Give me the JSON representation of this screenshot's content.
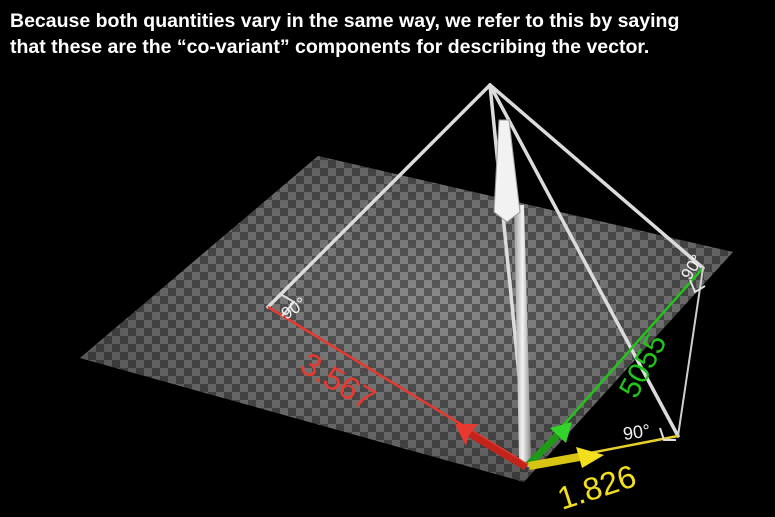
{
  "caption": {
    "line1": "Because both quantities vary in the same way, we refer to this by saying",
    "line2": "that these are the “co-variant” components for describing the vector."
  },
  "labels": {
    "red_value": "3.567",
    "green_value": "5055",
    "yellow_value": "1.826",
    "angle_red": "90°",
    "angle_green": "90°",
    "angle_yellow": "90°"
  },
  "colors": {
    "red": "#e8392f",
    "green": "#22c41a",
    "yellow": "#f2e01e",
    "white": "#e8e8e8"
  }
}
